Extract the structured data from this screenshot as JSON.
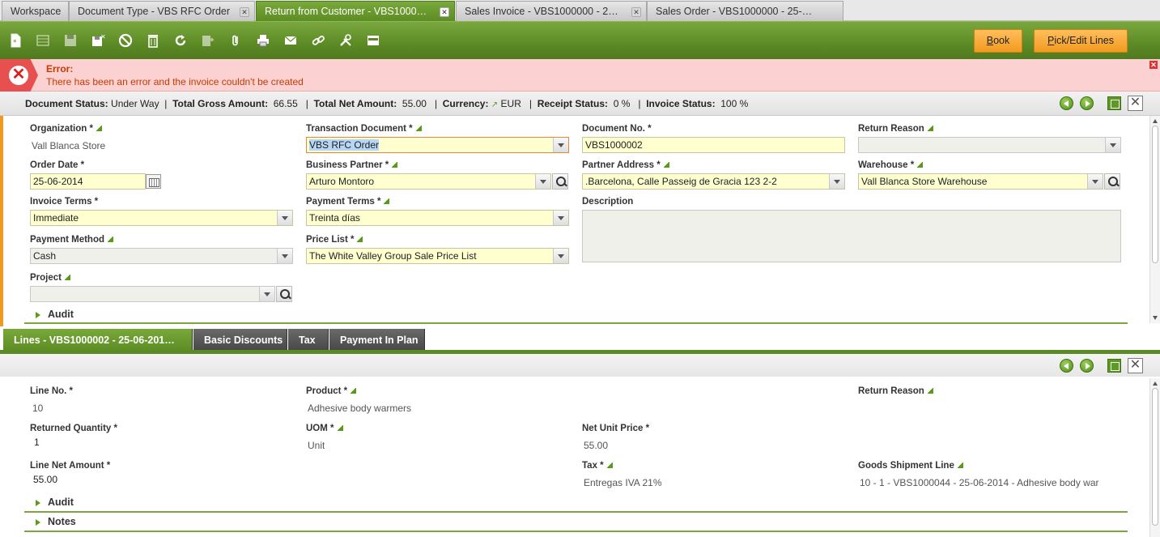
{
  "tabs": [
    {
      "label": "Workspace",
      "closable": false
    },
    {
      "label": "Document Type - VBS RFC Order",
      "closable": true
    },
    {
      "label": "Return from Customer - VBS1000…",
      "closable": true,
      "active": true
    },
    {
      "label": "Sales Invoice - VBS1000000 - 2…",
      "closable": true
    },
    {
      "label": "Sales Order - VBS1000000 - 25-…",
      "closable": false
    }
  ],
  "toolbar": {
    "icons": [
      "new-document-icon",
      "new-row-icon",
      "save-icon",
      "save-close-icon",
      "undo-icon",
      "delete-icon",
      "refresh-icon",
      "export-icon",
      "attachment-icon",
      "print-icon",
      "email-icon",
      "link-icon",
      "tools-icon",
      "grid-view-icon"
    ],
    "book_label": "Book",
    "book_underline": "B",
    "book_rest": "ook",
    "pick_label_underline": "P",
    "pick_label_rest": "ick/Edit Lines"
  },
  "error": {
    "title": "Error:",
    "message": "There has been an error and the invoice couldn't be created"
  },
  "status": {
    "doc_status_label": "Document Status:",
    "doc_status_value": "Under Way",
    "gross_label": "Total Gross Amount:",
    "gross_value": "66.55",
    "net_label": "Total Net Amount:",
    "net_value": "55.00",
    "currency_label": "Currency:",
    "currency_value": "EUR",
    "receipt_label": "Receipt Status:",
    "receipt_value": "0 %",
    "invoice_label": "Invoice Status:",
    "invoice_value": "100 %",
    "sep": "|"
  },
  "header": {
    "organization_label": "Organization *",
    "organization_value": "Vall Blanca Store",
    "transaction_doc_label": "Transaction Document *",
    "transaction_doc_value": "VBS RFC Order",
    "document_no_label": "Document No. *",
    "document_no_value": "VBS1000002",
    "return_reason_label": "Return Reason",
    "return_reason_value": "",
    "order_date_label": "Order Date *",
    "order_date_value": "25-06-2014",
    "business_partner_label": "Business Partner *",
    "business_partner_value": "Arturo Montoro",
    "partner_address_label": "Partner Address *",
    "partner_address_value": ".Barcelona, Calle Passeig de Gracia 123 2-2",
    "warehouse_label": "Warehouse *",
    "warehouse_value": "Vall Blanca Store Warehouse",
    "invoice_terms_label": "Invoice Terms *",
    "invoice_terms_value": "Immediate",
    "payment_terms_label": "Payment Terms *",
    "payment_terms_value": "Treinta días",
    "description_label": "Description",
    "payment_method_label": "Payment Method",
    "payment_method_value": "Cash",
    "price_list_label": "Price List *",
    "price_list_value": "The White Valley Group Sale Price List",
    "project_label": "Project",
    "project_value": "",
    "audit_label": "Audit"
  },
  "subtabs": [
    {
      "label": "Lines - VBS1000002 - 25-06-201…",
      "active": true
    },
    {
      "label": "Basic Discounts"
    },
    {
      "label": "Tax"
    },
    {
      "label": "Payment In Plan"
    }
  ],
  "lines": {
    "line_no_label": "Line No. *",
    "line_no_value": "10",
    "product_label": "Product *",
    "product_value": "Adhesive body warmers",
    "return_reason_label": "Return Reason",
    "returned_qty_label": "Returned Quantity *",
    "returned_qty_value": "1",
    "uom_label": "UOM *",
    "uom_value": "Unit",
    "net_unit_price_label": "Net Unit Price *",
    "net_unit_price_value": "55.00",
    "line_net_amount_label": "Line Net Amount *",
    "line_net_amount_value": "55.00",
    "tax_label": "Tax *",
    "tax_value": "Entregas IVA 21%",
    "goods_shipment_label": "Goods Shipment Line",
    "goods_shipment_value": "10 - 1 - VBS1000044 - 25-06-2014 - Adhesive body war",
    "audit_label": "Audit",
    "notes_label": "Notes"
  }
}
